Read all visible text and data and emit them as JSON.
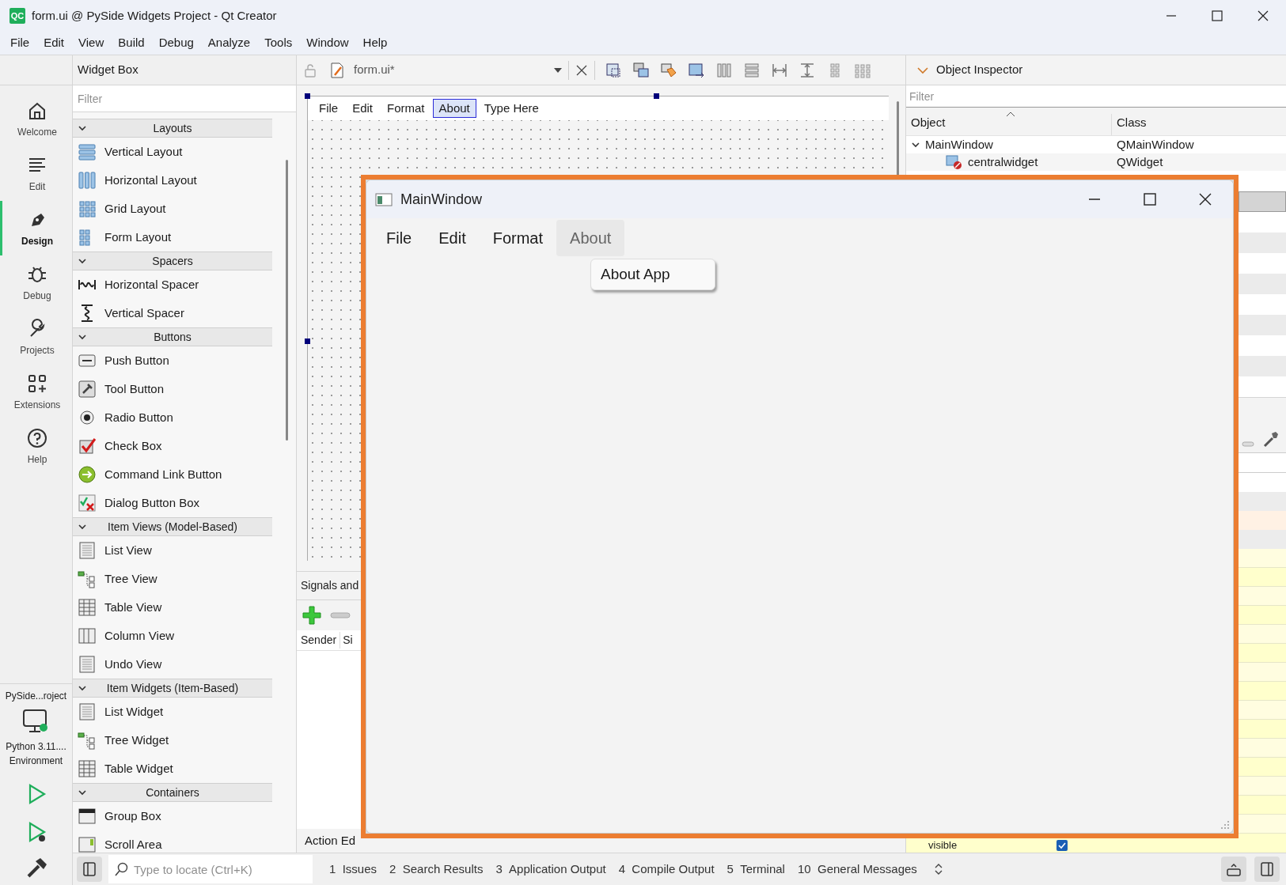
{
  "window": {
    "title": "form.ui @ PySide Widgets Project - Qt Creator",
    "app_badge": "QC"
  },
  "menu_bar": [
    "File",
    "Edit",
    "View",
    "Build",
    "Debug",
    "Analyze",
    "Tools",
    "Window",
    "Help"
  ],
  "mode_bar": {
    "modes": [
      {
        "label": "Welcome",
        "kind": "home",
        "selected": false
      },
      {
        "label": "Edit",
        "kind": "lines",
        "selected": false
      },
      {
        "label": "Design",
        "kind": "pen",
        "selected": true
      },
      {
        "label": "Debug",
        "kind": "bug",
        "selected": false
      },
      {
        "label": "Projects",
        "kind": "wrench",
        "selected": false
      },
      {
        "label": "Extensions",
        "kind": "extensions",
        "selected": false
      },
      {
        "label": "Help",
        "kind": "help",
        "selected": false
      }
    ],
    "project": "PySide...roject",
    "kit": "Python 3.11....",
    "kit_detail": "Environment"
  },
  "widget_box": {
    "title": "Widget Box",
    "filter_placeholder": "Filter",
    "categories": [
      {
        "label": "Layouts",
        "expanded": true,
        "items": [
          {
            "label": "Vertical Layout",
            "kind": "vlayout"
          },
          {
            "label": "Horizontal Layout",
            "kind": "hlayout"
          },
          {
            "label": "Grid Layout",
            "kind": "grid"
          },
          {
            "label": "Form Layout",
            "kind": "form"
          }
        ]
      },
      {
        "label": "Spacers",
        "expanded": true,
        "items": [
          {
            "label": "Horizontal Spacer",
            "kind": "hspacer"
          },
          {
            "label": "Vertical Spacer",
            "kind": "vspacer"
          }
        ]
      },
      {
        "label": "Buttons",
        "expanded": true,
        "items": [
          {
            "label": "Push Button",
            "kind": "push"
          },
          {
            "label": "Tool Button",
            "kind": "tool"
          },
          {
            "label": "Radio Button",
            "kind": "radio"
          },
          {
            "label": "Check Box",
            "kind": "check"
          },
          {
            "label": "Command Link Button",
            "kind": "command"
          },
          {
            "label": "Dialog Button Box",
            "kind": "dialog"
          }
        ]
      },
      {
        "label": "Item Views (Model-Based)",
        "expanded": true,
        "items": [
          {
            "label": "List View",
            "kind": "list"
          },
          {
            "label": "Tree View",
            "kind": "tree"
          },
          {
            "label": "Table View",
            "kind": "table"
          },
          {
            "label": "Column View",
            "kind": "column"
          },
          {
            "label": "Undo View",
            "kind": "list"
          }
        ]
      },
      {
        "label": "Item Widgets (Item-Based)",
        "expanded": true,
        "items": [
          {
            "label": "List Widget",
            "kind": "list"
          },
          {
            "label": "Tree Widget",
            "kind": "tree"
          },
          {
            "label": "Table Widget",
            "kind": "table"
          }
        ]
      },
      {
        "label": "Containers",
        "expanded": true,
        "items": [
          {
            "label": "Group Box",
            "kind": "group"
          },
          {
            "label": "Scroll Area",
            "kind": "scroll"
          }
        ]
      }
    ]
  },
  "editor": {
    "file": "form.ui*",
    "form_menu": [
      {
        "label": "File",
        "selected": false
      },
      {
        "label": "Edit",
        "selected": false
      },
      {
        "label": "Format",
        "selected": false
      },
      {
        "label": "About",
        "selected": true
      },
      {
        "label": "Type Here",
        "selected": false
      }
    ],
    "signals_title": "Signals and",
    "columns": [
      "Sender",
      "Si"
    ],
    "bottom_tab": "Action Ed"
  },
  "object_inspector": {
    "title": "Object Inspector",
    "filter_placeholder": "Filter",
    "columns": [
      "Object",
      "Class"
    ],
    "rows": [
      {
        "object": "MainWindow",
        "class": "QMainWindow",
        "expanded": true,
        "children": [
          {
            "object": "centralwidget",
            "class": "QWidget"
          }
        ]
      }
    ]
  },
  "property_editor": {
    "last_property": "visible",
    "checked": true
  },
  "preview": {
    "title": "MainWindow",
    "menus": [
      {
        "label": "File",
        "selected": false
      },
      {
        "label": "Edit",
        "selected": false
      },
      {
        "label": "Format",
        "selected": false
      },
      {
        "label": "About",
        "selected": true
      }
    ],
    "dropdown": [
      "About App"
    ]
  },
  "status_bar": {
    "locate_placeholder": "Type to locate (Ctrl+K)",
    "panes": [
      {
        "number": "1",
        "label": "Issues"
      },
      {
        "number": "2",
        "label": "Search Results"
      },
      {
        "number": "3",
        "label": "Application Output"
      },
      {
        "number": "4",
        "label": "Compile Output"
      },
      {
        "number": "5",
        "label": "Terminal"
      },
      {
        "number": "10",
        "label": "General Messages"
      }
    ]
  }
}
